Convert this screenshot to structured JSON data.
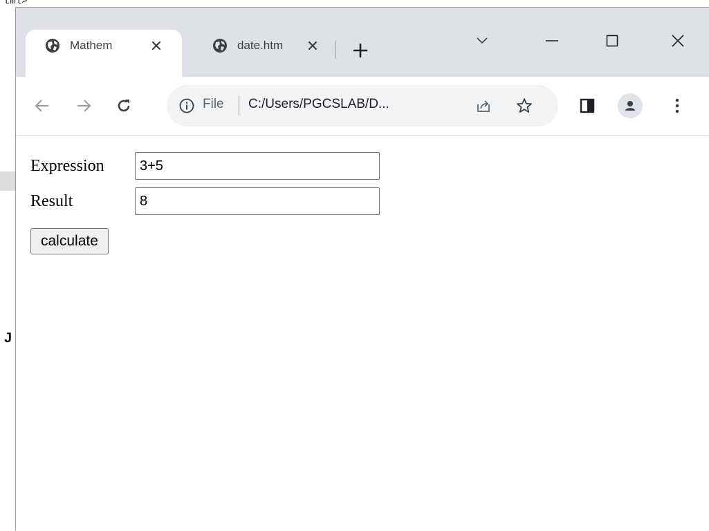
{
  "background": {
    "top_fragment_text": "tml>",
    "left_fragment_text": "J"
  },
  "browser": {
    "tabs": [
      {
        "title": "Mathem",
        "active": true,
        "icon": "globe-icon"
      },
      {
        "title": "date.htm",
        "active": false,
        "icon": "globe-icon"
      }
    ],
    "omnibox": {
      "scheme_label": "File",
      "url": "C:/Users/PGCSLAB/D..."
    }
  },
  "page": {
    "expression_label": "Expression",
    "expression_value": "3+5",
    "result_label": "Result",
    "result_value": "8",
    "calculate_label": "calculate"
  }
}
